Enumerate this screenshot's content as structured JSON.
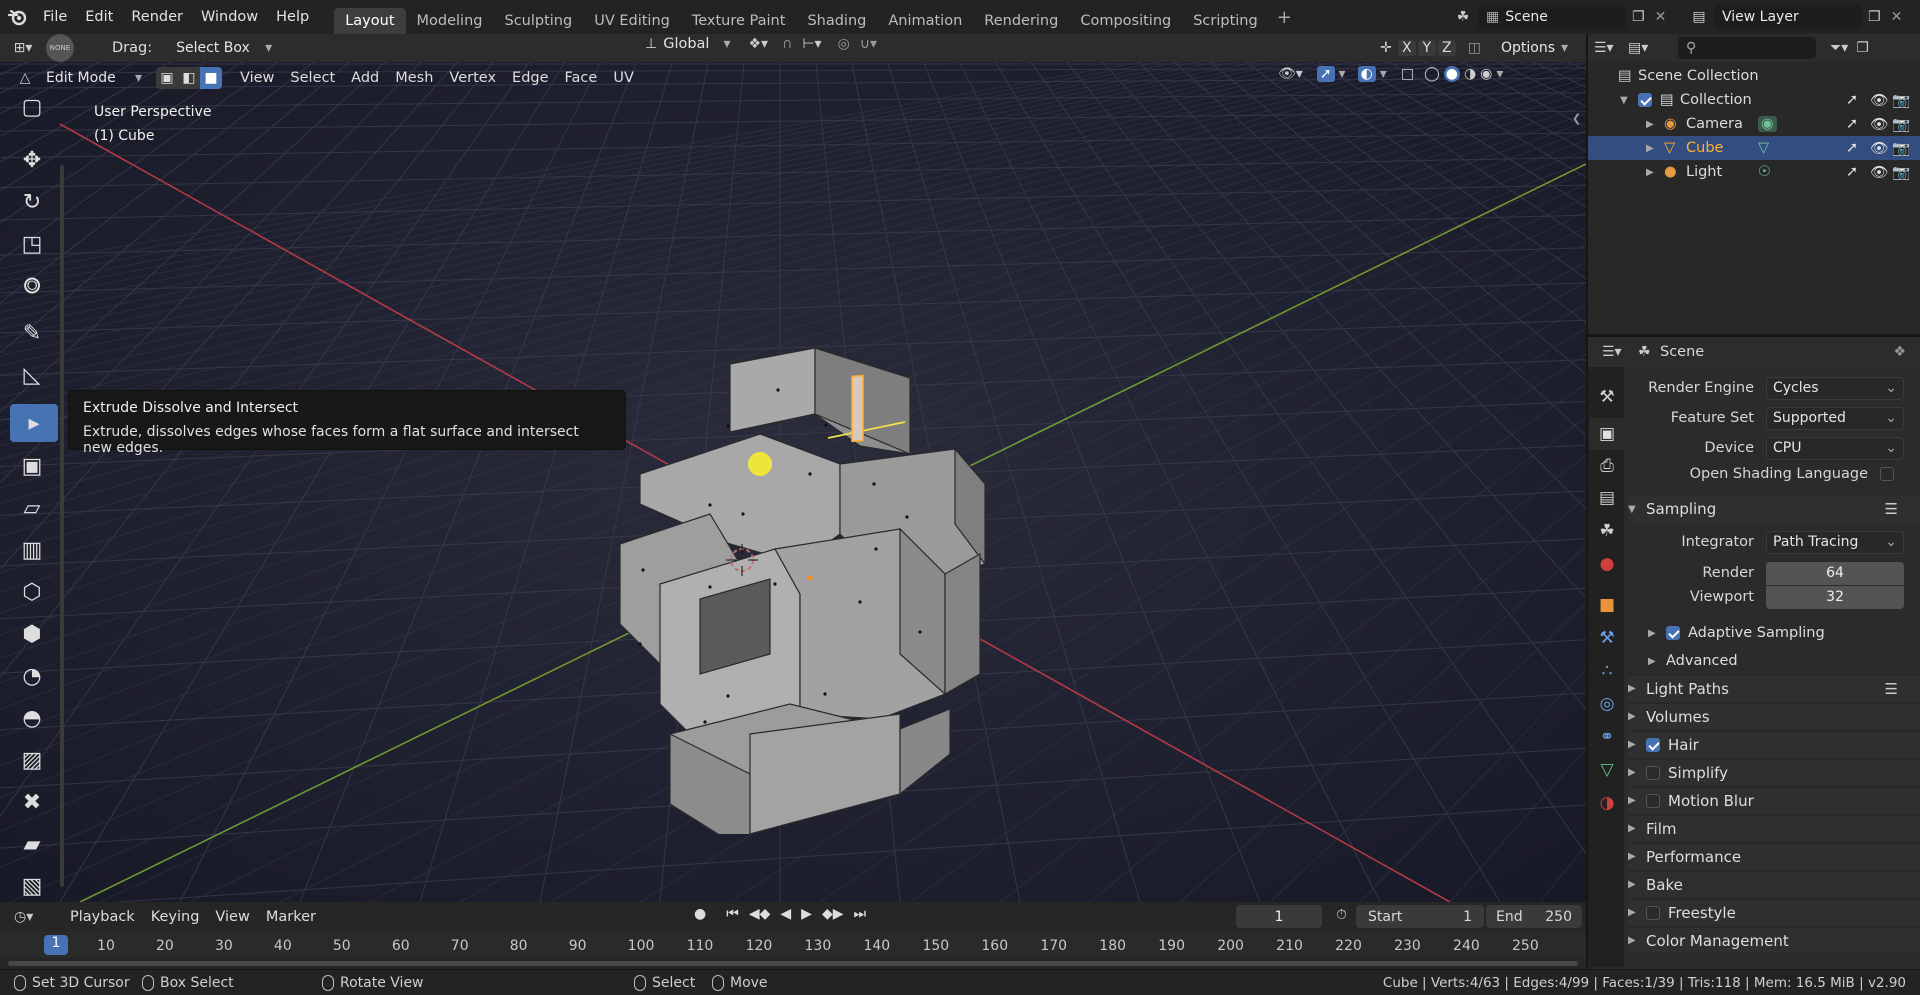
{
  "topbar": {
    "menus": [
      "File",
      "Edit",
      "Render",
      "Window",
      "Help"
    ],
    "workspaces": [
      "Layout",
      "Modeling",
      "Sculpting",
      "UV Editing",
      "Texture Paint",
      "Shading",
      "Animation",
      "Rendering",
      "Compositing",
      "Scripting"
    ],
    "add_label": "+",
    "scene": "Scene",
    "view_layer": "View Layer"
  },
  "tool_header": {
    "drag_label": "Drag:",
    "drag_value": "Select Box",
    "orientation": "Global",
    "options": "Options",
    "axes": [
      "X",
      "Y",
      "Z"
    ],
    "none_badge": "NONE"
  },
  "editor_header": {
    "mode": "Edit Mode",
    "menus": [
      "View",
      "Select",
      "Add",
      "Mesh",
      "Vertex",
      "Edge",
      "Face",
      "UV"
    ]
  },
  "viewport": {
    "title": "User Perspective",
    "object": "(1) Cube"
  },
  "tooltip": {
    "title": "Extrude Dissolve and Intersect",
    "desc": "Extrude, dissolves edges whose faces form a flat surface and intersect new edges."
  },
  "outliner": {
    "root": "Scene Collection",
    "collection": "Collection",
    "items": [
      {
        "name": "Camera"
      },
      {
        "name": "Cube"
      },
      {
        "name": "Light"
      }
    ]
  },
  "properties": {
    "context": "Scene",
    "render_engine_label": "Render Engine",
    "render_engine": "Cycles",
    "feature_set_label": "Feature Set",
    "feature_set": "Supported",
    "device_label": "Device",
    "device": "CPU",
    "osl_label": "Open Shading Language",
    "sampling": "Sampling",
    "integrator_label": "Integrator",
    "integrator": "Path Tracing",
    "render_label": "Render",
    "render_value": "64",
    "viewport_label": "Viewport",
    "viewport_value": "32",
    "adaptive": "Adaptive Sampling",
    "advanced": "Advanced",
    "panels": [
      {
        "label": "Light Paths",
        "check": null
      },
      {
        "label": "Volumes",
        "check": null
      },
      {
        "label": "Hair",
        "check": true
      },
      {
        "label": "Simplify",
        "check": false
      },
      {
        "label": "Motion Blur",
        "check": false
      },
      {
        "label": "Film",
        "check": null
      },
      {
        "label": "Performance",
        "check": null
      },
      {
        "label": "Bake",
        "check": null
      },
      {
        "label": "Freestyle",
        "check": false
      },
      {
        "label": "Color Management",
        "check": null
      }
    ]
  },
  "timeline": {
    "menus": [
      "Playback",
      "Keying",
      "View",
      "Marker"
    ],
    "current_frame": "1",
    "start_label": "Start",
    "start": "1",
    "end_label": "End",
    "end": "250",
    "ticks": [
      "1",
      "10",
      "20",
      "30",
      "40",
      "50",
      "60",
      "70",
      "80",
      "90",
      "100",
      "110",
      "120",
      "130",
      "140",
      "150",
      "160",
      "170",
      "180",
      "190",
      "200",
      "210",
      "220",
      "230",
      "240",
      "250"
    ]
  },
  "statusbar": {
    "items": [
      "Set 3D Cursor",
      "Box Select",
      "Rotate View",
      "Select",
      "Move"
    ],
    "stats": "Cube | Verts:4/63 | Edges:4/99 | Faces:1/39 | Tris:118 | Mem: 16.5 MiB | v2.90"
  },
  "colors": {
    "accent": "#4772b3",
    "selected": "#ffaf29",
    "x_axis": "#d03c4a",
    "y_axis": "#7ab33a",
    "viewport_bg": "#1b1c2b"
  }
}
